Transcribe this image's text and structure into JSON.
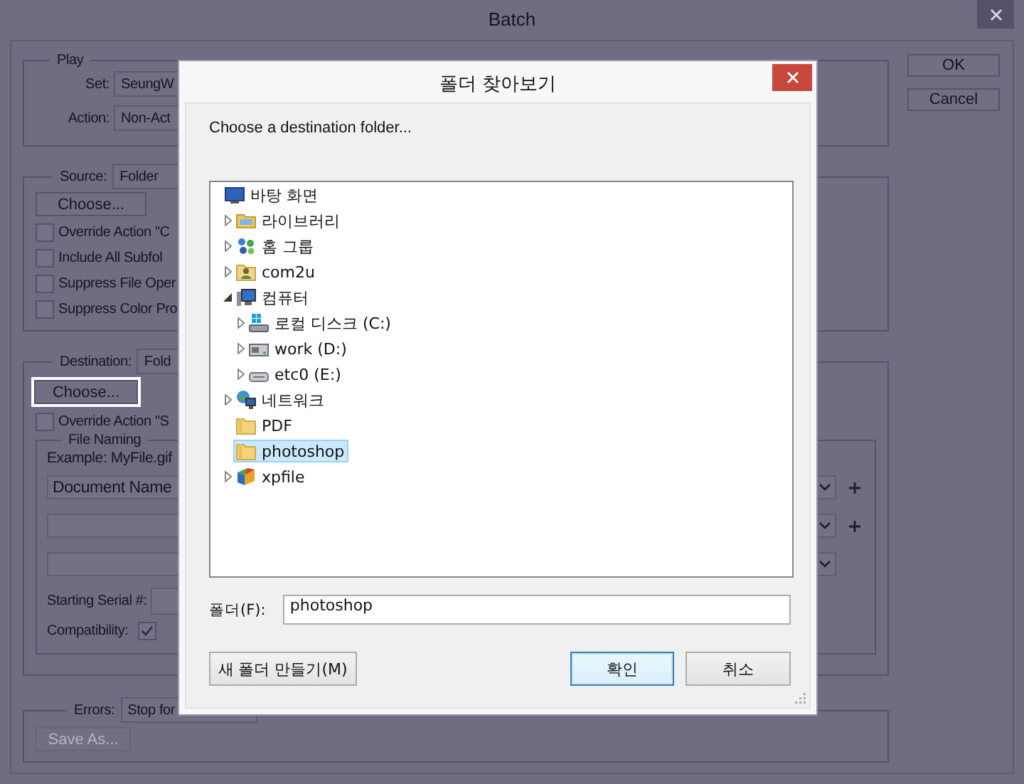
{
  "window": {
    "title": "Batch"
  },
  "play": {
    "legend": "Play",
    "set_label": "Set:",
    "set_value": "SeungW",
    "action_label": "Action:",
    "action_value": "Non-Act"
  },
  "source": {
    "label": "Source:",
    "value": "Folder",
    "choose": "Choose...",
    "options": [
      {
        "label": "Override Action \"C",
        "checked": false
      },
      {
        "label": "Include All Subfol",
        "checked": false
      },
      {
        "label": "Suppress File Oper",
        "checked": false
      },
      {
        "label": "Suppress Color Pro",
        "checked": false
      }
    ]
  },
  "destination": {
    "label": "Destination:",
    "value": "Fold",
    "choose": "Choose...",
    "choose_focused": true,
    "override": {
      "label": "Override Action \"S",
      "checked": false
    },
    "file_naming": {
      "legend": "File Naming",
      "example": "Example: MyFile.gif",
      "fields": [
        {
          "value": "Document Name",
          "addable": true
        },
        {
          "addable": true
        },
        {
          "addable": false
        }
      ],
      "serial_label": "Starting Serial #:",
      "compat_label": "Compatibility:",
      "compat_checked": true
    }
  },
  "errors": {
    "label": "Errors:",
    "value": "Stop for",
    "save_as": "Save As...",
    "save_as_disabled": true
  },
  "buttons": [
    {
      "label": "OK"
    },
    {
      "label": "Cancel"
    }
  ],
  "dialog": {
    "title": "폴더 찾아보기",
    "prompt": "Choose a destination folder...",
    "tree": [
      {
        "label": "바탕 화면",
        "kind": "desktop",
        "expandable": false,
        "selected": false,
        "children": [
          {
            "label": "라이브러리",
            "kind": "library",
            "expandable": true,
            "selected": false
          },
          {
            "label": "홈 그룹",
            "kind": "homegroup",
            "expandable": true,
            "selected": false
          },
          {
            "label": "com2u",
            "kind": "user",
            "expandable": true,
            "selected": false
          },
          {
            "label": "컴퓨터",
            "kind": "computer",
            "expandable": true,
            "selected": false,
            "children": [
              {
                "label": "로컬 디스크 (C:)",
                "kind": "system-disk",
                "expandable": true,
                "selected": false
              },
              {
                "label": "work (D:)",
                "kind": "disk",
                "expandable": true,
                "selected": false
              },
              {
                "label": "etc0 (E:)",
                "kind": "drive",
                "expandable": true,
                "selected": false
              }
            ]
          },
          {
            "label": "네트워크",
            "kind": "network",
            "expandable": true,
            "selected": false
          },
          {
            "label": "PDF",
            "kind": "folder",
            "expandable": false,
            "selected": false
          },
          {
            "label": "photoshop",
            "kind": "folder",
            "expandable": false,
            "selected": true
          },
          {
            "label": "xpfile",
            "kind": "app",
            "expandable": true,
            "selected": false
          }
        ]
      }
    ],
    "folder_label": "폴더(F):",
    "folder_value": "photoshop",
    "buttons": [
      {
        "label": "새 폴더 만들기(M)",
        "default": false
      },
      {
        "label": "확인",
        "default": true
      },
      {
        "label": "취소",
        "default": false
      }
    ]
  }
}
